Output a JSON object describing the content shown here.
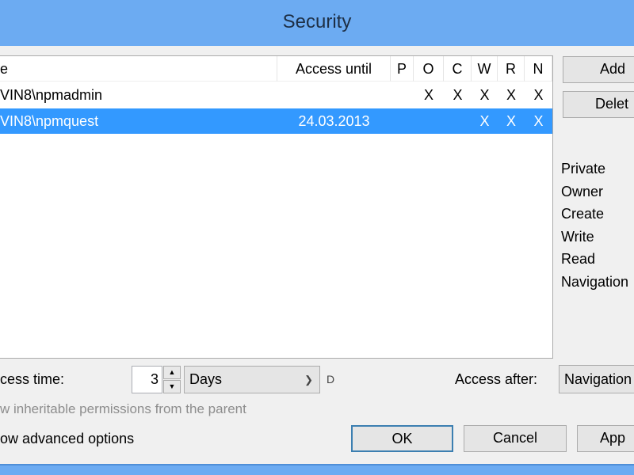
{
  "window": {
    "title": "Security"
  },
  "grid": {
    "columns": [
      "e",
      "Access until",
      "P",
      "O",
      "C",
      "W",
      "R",
      "N"
    ],
    "rows": [
      {
        "name": "VIN8\\npmadmin",
        "access_until": "",
        "marks": [
          "",
          "X",
          "X",
          "X",
          "X",
          "X"
        ],
        "selected": false
      },
      {
        "name": "VIN8\\npmquest",
        "access_until": "24.03.2013",
        "marks": [
          "",
          "",
          "",
          "X",
          "X",
          "X"
        ],
        "selected": true
      }
    ]
  },
  "side": {
    "add": "Add",
    "delete": "Delet",
    "legend": [
      "Private",
      "Owner",
      "Create",
      "Write",
      "Read",
      "Navigation"
    ]
  },
  "access": {
    "time_label": "cess time:",
    "time_value": "3",
    "unit": "Days",
    "unit_suffix": "D",
    "after_label": "Access after:",
    "after_value": "Navigation"
  },
  "options": {
    "inherit": "w inheritable permissions from the parent",
    "advanced": "ow advanced options"
  },
  "buttons": {
    "ok": "OK",
    "cancel": "Cancel",
    "apply": "App"
  },
  "colors": {
    "titlebar": "#6cabf2",
    "selection": "#3399ff"
  }
}
